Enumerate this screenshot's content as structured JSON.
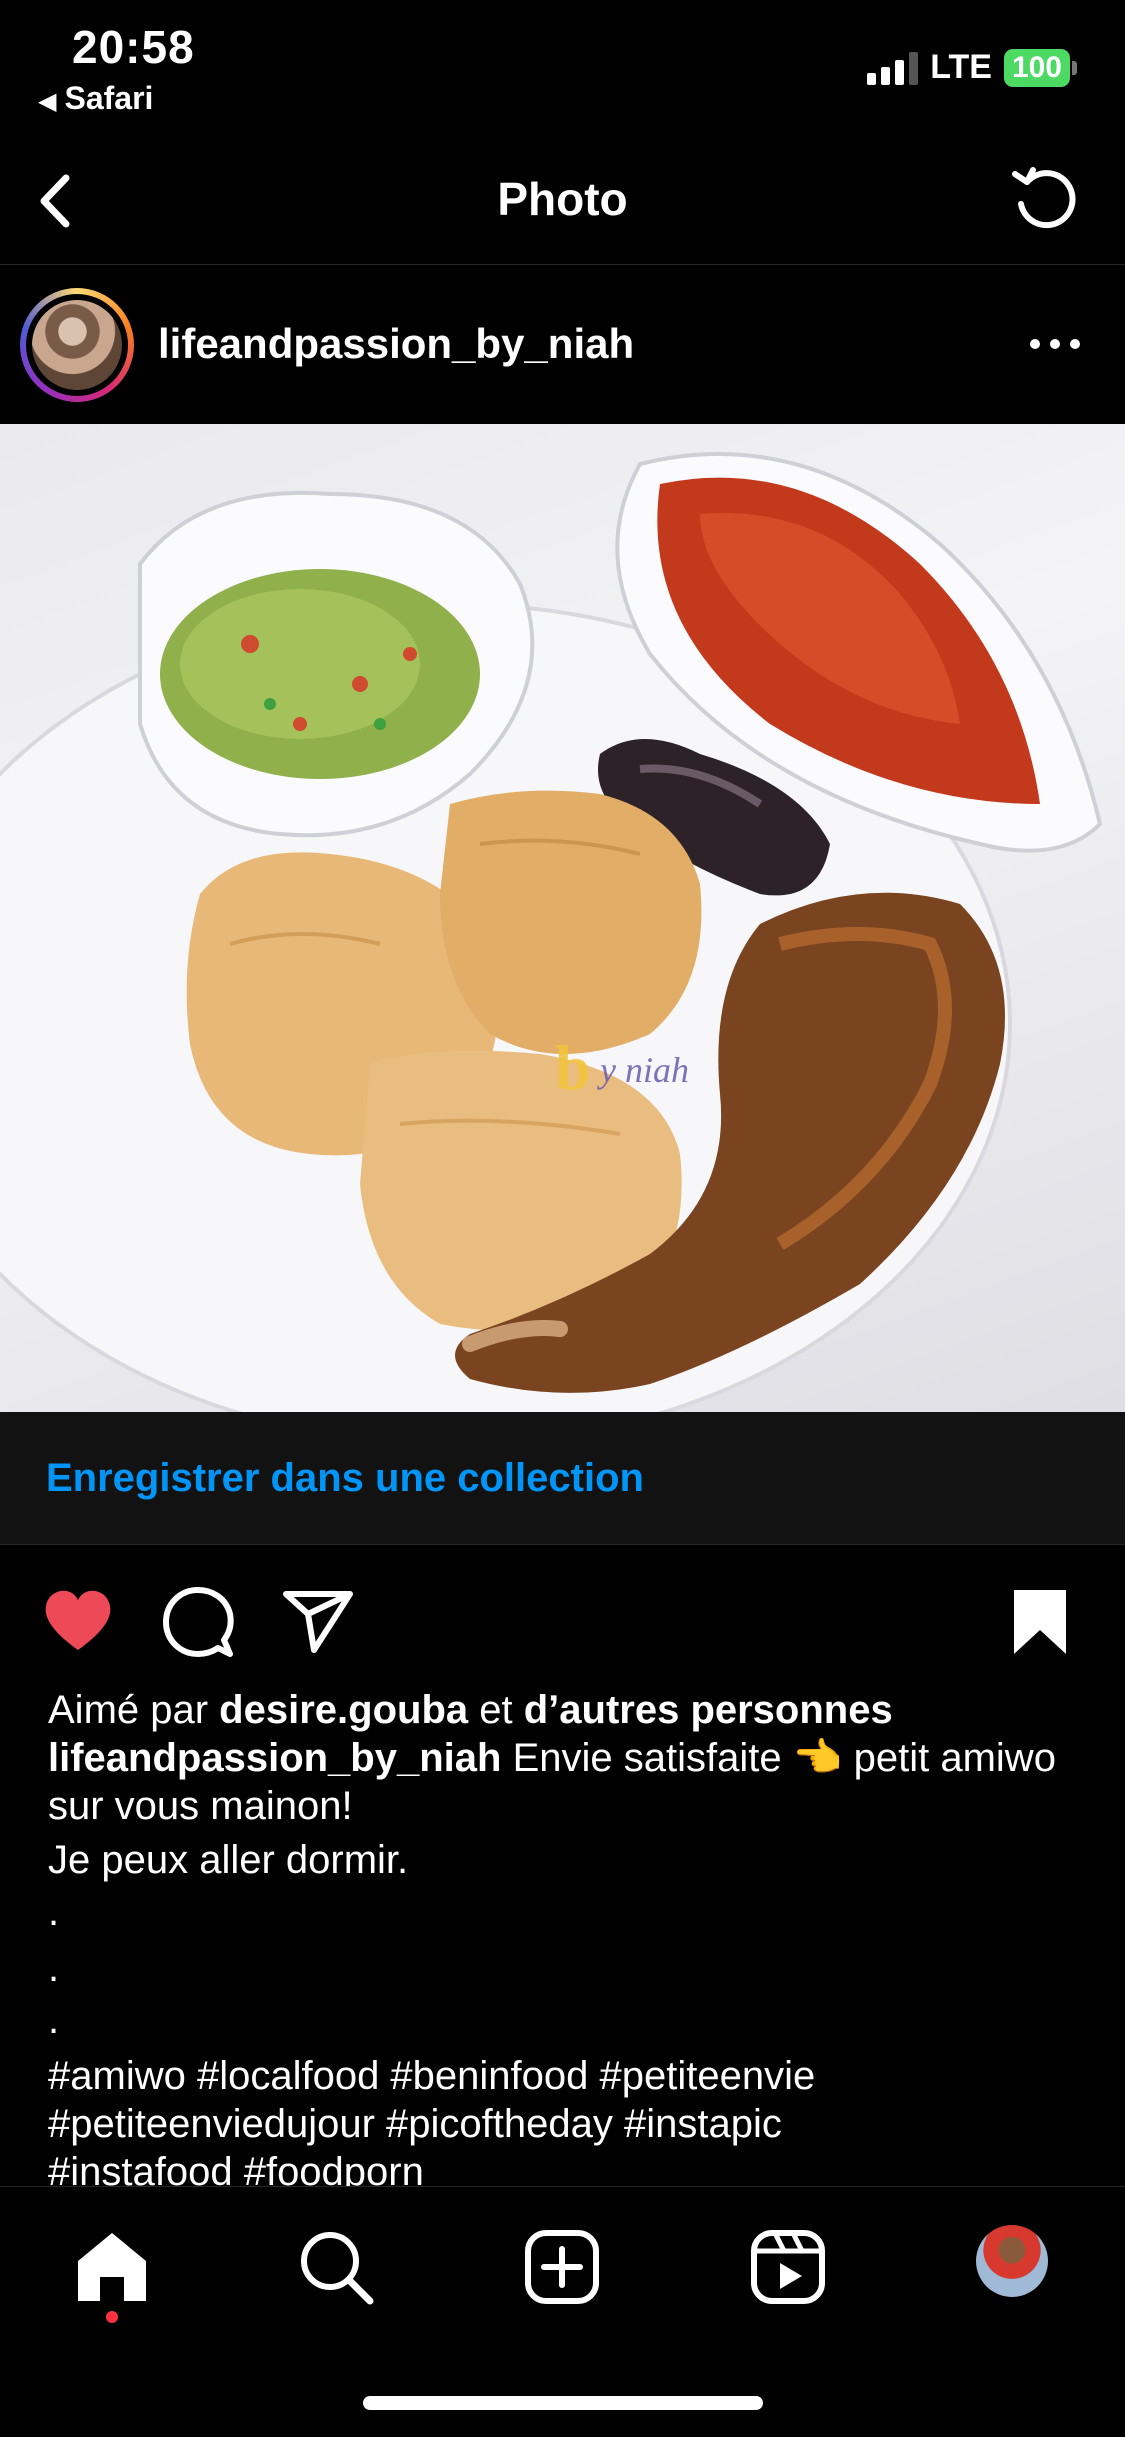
{
  "status_bar": {
    "time": "20:58",
    "back_app": "Safari",
    "network": "LTE",
    "battery": "100",
    "battery_color": "#4cd964"
  },
  "nav": {
    "title": "Photo",
    "back_icon": "chevron-left-icon",
    "refresh_icon": "refresh-icon"
  },
  "post": {
    "username": "lifeandpassion_by_niah",
    "more_icon": "more-horizontal-icon",
    "watermark": "by niah"
  },
  "collection": {
    "label": "Enregistrer dans une collection",
    "color": "#0095f6"
  },
  "actions": {
    "like_icon": "heart-filled-icon",
    "comment_icon": "comment-icon",
    "share_icon": "send-icon",
    "save_icon": "bookmark-filled-icon",
    "like_color": "#ed4956"
  },
  "likes": {
    "prefix": "Aimé par ",
    "user": "desire.gouba",
    "middle": " et ",
    "others": "d’autres personnes"
  },
  "caption": {
    "username": "lifeandpassion_by_niah",
    "text": " Envie satisfaite 👈 petit amiwo sur vous mainon!",
    "line2": "Je peux aller dormir.",
    "dots": [
      ".",
      ".",
      "."
    ],
    "hashtags_line1": "#amiwo #localfood #beninfood #petiteenvie",
    "hashtags_line2": "#petiteenviedujour #picoftheday #instapic",
    "hashtags_line3": "#instafood #foodporn"
  },
  "tabbar": {
    "items": [
      "home-icon",
      "search-icon",
      "create-icon",
      "reels-icon",
      "profile-avatar"
    ],
    "active": "home-icon",
    "notif_color": "#ff3040"
  }
}
